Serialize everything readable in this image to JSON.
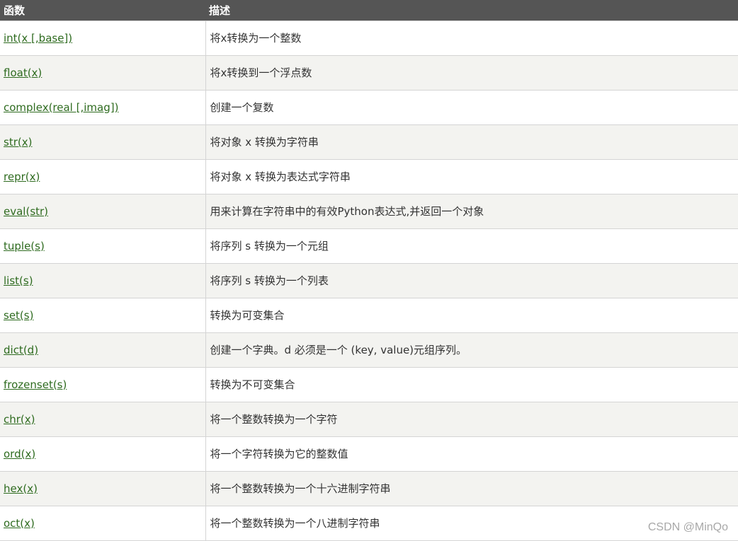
{
  "table": {
    "headers": {
      "function": "函数",
      "description": "描述"
    },
    "rows": [
      {
        "fn": "int(x [,base])",
        "desc": "将x转换为一个整数"
      },
      {
        "fn": "float(x)",
        "desc": "将x转换到一个浮点数"
      },
      {
        "fn": "complex(real [,imag])",
        "desc": "创建一个复数"
      },
      {
        "fn": "str(x)",
        "desc": "将对象 x 转换为字符串"
      },
      {
        "fn": "repr(x)",
        "desc": "将对象 x 转换为表达式字符串"
      },
      {
        "fn": "eval(str)",
        "desc": "用来计算在字符串中的有效Python表达式,并返回一个对象"
      },
      {
        "fn": "tuple(s)",
        "desc": "将序列 s 转换为一个元组"
      },
      {
        "fn": "list(s)",
        "desc": "将序列 s 转换为一个列表"
      },
      {
        "fn": "set(s)",
        "desc": "转换为可变集合"
      },
      {
        "fn": "dict(d)",
        "desc": "创建一个字典。d 必须是一个 (key, value)元组序列。"
      },
      {
        "fn": "frozenset(s)",
        "desc": "转换为不可变集合"
      },
      {
        "fn": "chr(x)",
        "desc": "将一个整数转换为一个字符"
      },
      {
        "fn": "ord(x)",
        "desc": "将一个字符转换为它的整数值"
      },
      {
        "fn": "hex(x)",
        "desc": "将一个整数转换为一个十六进制字符串"
      },
      {
        "fn": "oct(x)",
        "desc": "将一个整数转换为一个八进制字符串"
      }
    ]
  },
  "watermark": "CSDN @MinQo",
  "colors": {
    "header_bg": "#555555",
    "link": "#2e6b1f",
    "row_alt": "#f3f3f0"
  }
}
